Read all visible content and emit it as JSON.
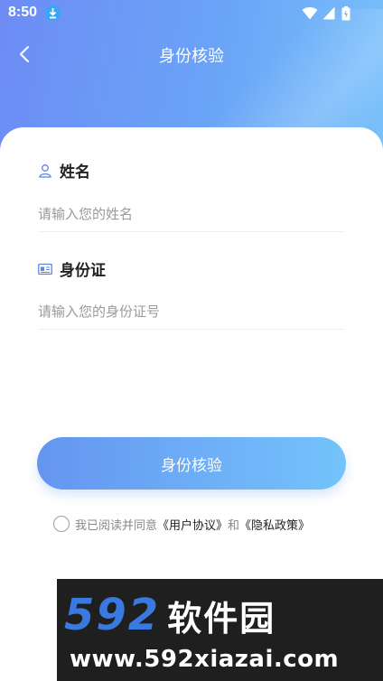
{
  "status_bar": {
    "time": "8:50"
  },
  "nav": {
    "title": "身份核验"
  },
  "form": {
    "name": {
      "label": "姓名",
      "placeholder": "请输入您的姓名",
      "value": ""
    },
    "id_card": {
      "label": "身份证",
      "placeholder": "请输入您的身份证号",
      "value": ""
    },
    "submit_label": "身份核验"
  },
  "agreement": {
    "prefix": "我已阅读并同意",
    "user_agreement": "《用户协议》",
    "conjunction": "和",
    "privacy_policy": "《隐私政策》",
    "checked": false
  },
  "watermark": {
    "digits": "592",
    "name": "软件园",
    "url": "www.592xiazai.com"
  },
  "colors": {
    "header_gradient_start": "#6d8cf5",
    "header_gradient_end": "#79c1fb",
    "button_gradient_start": "#6495ef",
    "button_gradient_end": "#73c3fb",
    "icon_blue": "#5b86e5",
    "watermark_blue": "#3a7ae0"
  },
  "icons": {
    "back": "chevron-left-icon",
    "name_field": "user-icon",
    "id_field": "id-card-icon",
    "download": "download-icon",
    "wifi": "wifi-icon",
    "signal": "signal-icon",
    "battery": "battery-icon"
  }
}
